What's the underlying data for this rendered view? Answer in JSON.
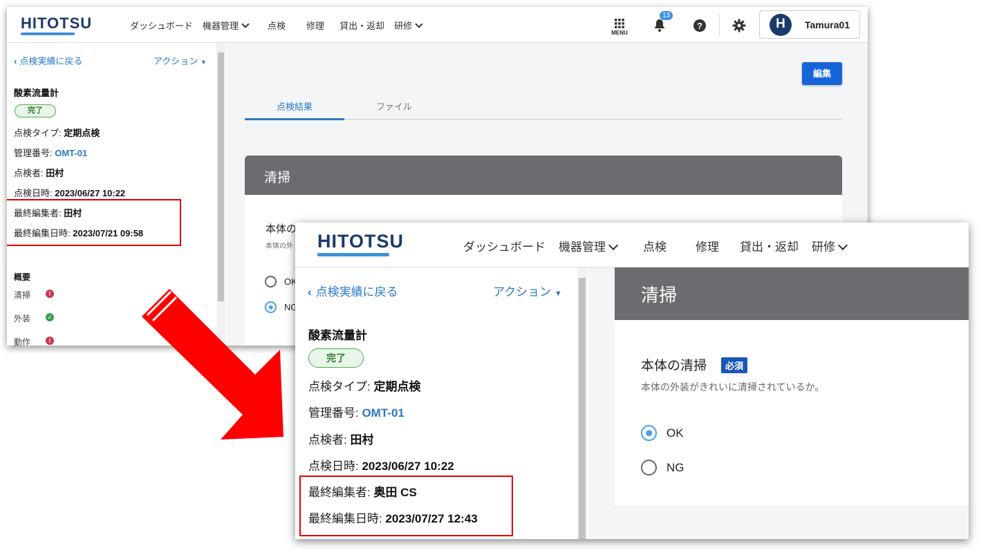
{
  "header": {
    "logo": "HITOTSU",
    "nav": [
      "ダッシュボード",
      "機器管理",
      "点検",
      "修理",
      "貸出・返却",
      "研修"
    ],
    "menu_label": "MENU",
    "notification_count": "13",
    "user_initial": "H",
    "user_name": "Tamura01"
  },
  "sidebar": {
    "back_link": "点検実績に戻る",
    "action_label": "アクション",
    "equipment_name": "酸素流量計",
    "status": "完了",
    "type_label": "点検タイプ: ",
    "type_value": "定期点検",
    "mgmt_label": "管理番号: ",
    "mgmt_value": "OMT-01",
    "inspector_label": "点検者: ",
    "inspector_value": "田村",
    "date_label": "点検日時: ",
    "date_value": "2023/06/27 10:22",
    "editor_label": "最終編集者: ",
    "editor_label_after": "最終編集者: ",
    "edited_label": "最終編集日時: ",
    "summary_title": "概要",
    "summary_items": [
      {
        "label": "清掃",
        "status": "error"
      },
      {
        "label": "外装",
        "status": "ok"
      },
      {
        "label": "動作",
        "status": "error"
      }
    ]
  },
  "before": {
    "last_editor": "田村",
    "last_edited": "2023/07/21 09:58"
  },
  "after": {
    "last_editor": "奥田 CS",
    "last_edited": "2023/07/27 12:43"
  },
  "main": {
    "edit_button": "編集",
    "tabs": [
      "点検結果",
      "ファイル"
    ],
    "active_tab": "点検結果",
    "section_title": "清掃",
    "question_title": "本体の清掃",
    "question_title_cut": "本体の",
    "required_badge": "必須",
    "question_desc": "本体の外装がきれいに清掃されているか。",
    "question_desc_cut": "本体の外",
    "options": [
      "OK",
      "NG"
    ],
    "option_cut_ok": "OK",
    "option_cut_ng": "NG",
    "selected_after": "OK",
    "selected_before": "NG"
  },
  "colors": {
    "brand_navy": "#1b3a6b",
    "link_blue": "#2b78c5",
    "button_blue": "#1565d8",
    "annotation_red": "#e00000",
    "section_gray": "#6b6c70"
  }
}
